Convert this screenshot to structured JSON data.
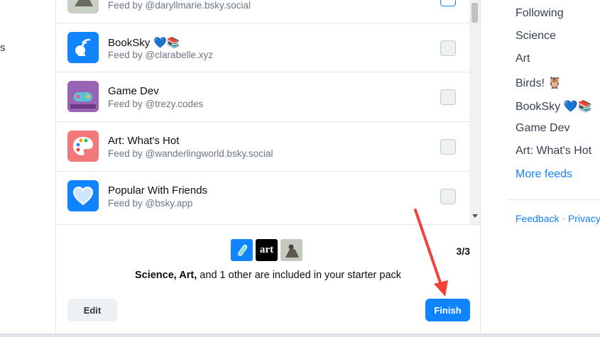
{
  "left_stub_text": "s",
  "feeds": [
    {
      "title": "",
      "subtitle": "Feed by @daryllmarie.bsky.social",
      "avatar": "bird-photo"
    },
    {
      "title": "BookSky",
      "subtitle": "Feed by @clarabelle.xyz",
      "avatar": "satellite-dish-icon",
      "emoji": "💙📚"
    },
    {
      "title": "Game Dev",
      "subtitle": "Feed by @trezy.codes",
      "avatar": "gamepad-image"
    },
    {
      "title": "Art: What's Hot",
      "subtitle": "Feed by @wanderlingworld.bsky.social",
      "avatar": "palette-icon"
    },
    {
      "title": "Popular With Friends",
      "subtitle": "Feed by @bsky.app",
      "avatar": "heart-icon"
    }
  ],
  "footer": {
    "count": "3/3",
    "summary_bold": "Science, Art,",
    "summary_rest": " and 1 other are included in your starter pack",
    "thumbs": [
      "test-tube-icon",
      "art-logo",
      "bird-photo"
    ],
    "art_text": "art",
    "edit_label": "Edit",
    "finish_label": "Finish"
  },
  "sidebar": {
    "items": [
      "Following",
      "Science",
      "Art",
      "Birds! 🦉",
      "BookSky 💙📚",
      "Game Dev",
      "Art: What's Hot"
    ],
    "more_feeds": "More feeds",
    "feedback": "Feedback",
    "separator": "·",
    "privacy": "Privacy"
  },
  "colors": {
    "accent": "#1083fe",
    "annotation": "#f0443a"
  }
}
